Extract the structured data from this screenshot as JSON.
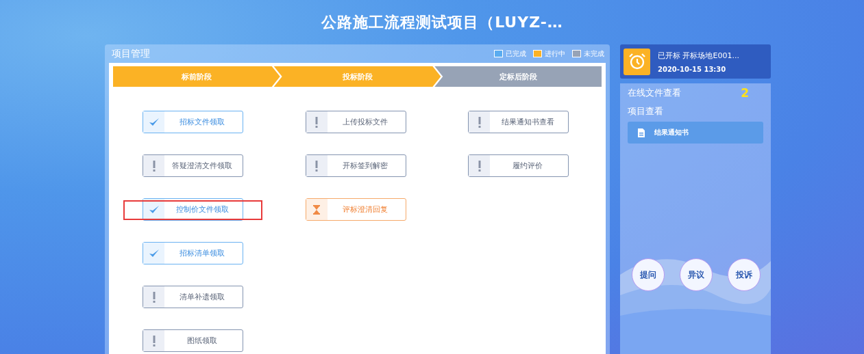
{
  "page_title": "公路施工流程测试项目（LUYZ-…",
  "panel": {
    "title": "项目管理",
    "legend": [
      {
        "label": "已完成",
        "color": "#5aacf0"
      },
      {
        "label": "进行中",
        "color": "#fbb225"
      },
      {
        "label": "未完成",
        "color": "#97a3b6"
      }
    ],
    "stages": [
      {
        "label": "标前阶段",
        "in_progress": true,
        "tasks": [
          {
            "label": "招标文件领取",
            "kind": "done",
            "highlighted": false
          },
          {
            "label": "答疑澄清文件领取",
            "kind": "pending",
            "highlighted": false
          },
          {
            "label": "控制价文件领取",
            "kind": "done",
            "highlighted": true
          },
          {
            "label": "招标清单领取",
            "kind": "done",
            "highlighted": false
          },
          {
            "label": "清单补遗领取",
            "kind": "pending",
            "highlighted": false
          },
          {
            "label": "图纸领取",
            "kind": "pending",
            "highlighted": false
          }
        ]
      },
      {
        "label": "投标阶段",
        "in_progress": true,
        "tasks": [
          {
            "label": "上传投标文件",
            "kind": "pending",
            "highlighted": false
          },
          {
            "label": "开标签到解密",
            "kind": "pending",
            "highlighted": false
          },
          {
            "label": "评标澄清回复",
            "kind": "progress",
            "highlighted": false
          }
        ]
      },
      {
        "label": "定标后阶段",
        "in_progress": false,
        "tasks": [
          {
            "label": "结果通知书查看",
            "kind": "pending",
            "highlighted": false
          },
          {
            "label": "履约评价",
            "kind": "pending",
            "highlighted": false
          }
        ]
      }
    ]
  },
  "notice": {
    "title": "已开标 开标场地E001...",
    "time": "2020-10-15 13:30"
  },
  "side": {
    "online_files": "在线文件查看",
    "count": "2",
    "project_view": "项目查看",
    "items": [
      "结果通知书"
    ],
    "actions": [
      "提问",
      "异议",
      "投诉"
    ]
  }
}
